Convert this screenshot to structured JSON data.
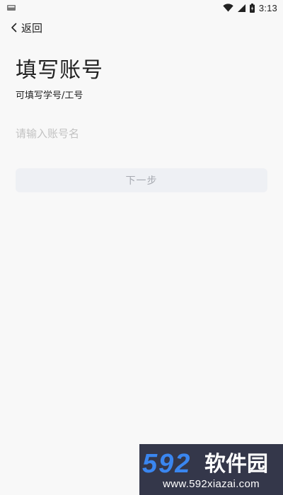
{
  "status_bar": {
    "time": "3:13",
    "icons": [
      "notification-icon",
      "wifi-icon",
      "signal-icon",
      "battery-icon"
    ]
  },
  "nav": {
    "back_label": "返回",
    "back_icon": "chevron-left-icon"
  },
  "page": {
    "title": "填写账号",
    "subtitle": "可填写学号/工号"
  },
  "form": {
    "account_placeholder": "请输入账号名",
    "account_value": "",
    "next_label": "下一步"
  },
  "watermark": {
    "logo_number": "592",
    "logo_text": "软件园",
    "domain": "www.592xiazai.com"
  },
  "colors": {
    "background": "#f8f8f8",
    "button_bg": "#eef0f4",
    "button_text": "#a6a9b0",
    "placeholder": "#c2c2c2",
    "watermark_bg": "#34374a",
    "watermark_blue": "#3a86f0"
  }
}
